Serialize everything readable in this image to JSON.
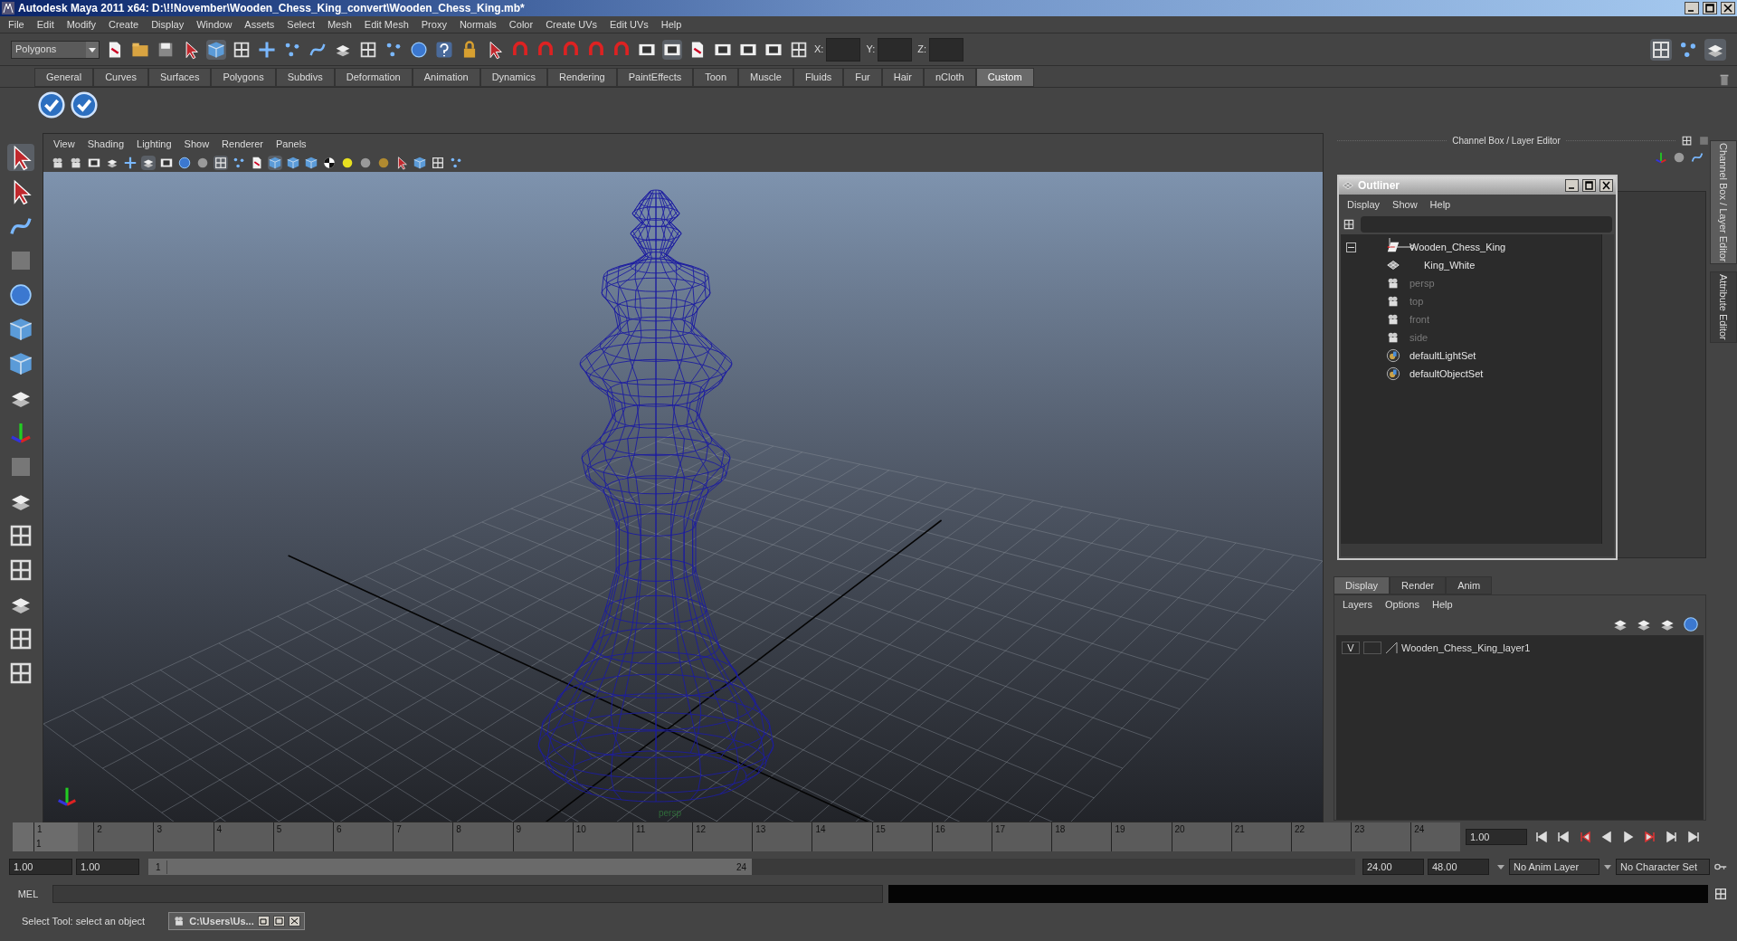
{
  "window": {
    "title": "Autodesk Maya 2011 x64: D:\\!!November\\Wooden_Chess_King_convert\\Wooden_Chess_King.mb*"
  },
  "menu_bar": [
    "File",
    "Edit",
    "Modify",
    "Create",
    "Display",
    "Window",
    "Assets",
    "Select",
    "Mesh",
    "Edit Mesh",
    "Proxy",
    "Normals",
    "Color",
    "Create UVs",
    "Edit UVs",
    "Help"
  ],
  "status_line": {
    "mode": "Polygons",
    "fields": [
      {
        "label": "X:"
      },
      {
        "label": "Y:"
      },
      {
        "label": "Z:"
      }
    ]
  },
  "shelf_tabs": [
    {
      "label": "General",
      "selected": false
    },
    {
      "label": "Curves",
      "selected": false
    },
    {
      "label": "Surfaces",
      "selected": false
    },
    {
      "label": "Polygons",
      "selected": false
    },
    {
      "label": "Subdivs",
      "selected": false
    },
    {
      "label": "Deformation",
      "selected": false
    },
    {
      "label": "Animation",
      "selected": false
    },
    {
      "label": "Dynamics",
      "selected": false
    },
    {
      "label": "Rendering",
      "selected": false
    },
    {
      "label": "PaintEffects",
      "selected": false
    },
    {
      "label": "Toon",
      "selected": false
    },
    {
      "label": "Muscle",
      "selected": false
    },
    {
      "label": "Fluids",
      "selected": false
    },
    {
      "label": "Fur",
      "selected": false
    },
    {
      "label": "Hair",
      "selected": false
    },
    {
      "label": "nCloth",
      "selected": false
    },
    {
      "label": "Custom",
      "selected": true
    }
  ],
  "viewport": {
    "menu": [
      "View",
      "Shading",
      "Lighting",
      "Show",
      "Renderer",
      "Panels"
    ],
    "camera_label": "persp"
  },
  "channel_box": {
    "title": "Channel Box / Layer Editor"
  },
  "side_tabs": [
    {
      "label": "Channel Box / Layer Editor",
      "selected": true
    },
    {
      "label": "Attribute Editor",
      "selected": false
    }
  ],
  "outliner": {
    "title": "Outliner",
    "menu": [
      "Display",
      "Show",
      "Help"
    ],
    "items": [
      {
        "label": "Wooden_Chess_King",
        "kind": "transform",
        "dimmed": false,
        "expanded": true,
        "children": [
          {
            "label": "King_White",
            "kind": "mesh",
            "dimmed": false
          }
        ]
      },
      {
        "label": "persp",
        "kind": "camera",
        "dimmed": true
      },
      {
        "label": "top",
        "kind": "camera",
        "dimmed": true
      },
      {
        "label": "front",
        "kind": "camera",
        "dimmed": true
      },
      {
        "label": "side",
        "kind": "camera",
        "dimmed": true
      },
      {
        "label": "defaultLightSet",
        "kind": "set",
        "dimmed": false
      },
      {
        "label": "defaultObjectSet",
        "kind": "set",
        "dimmed": false
      }
    ]
  },
  "layer_editor": {
    "tabs": [
      {
        "label": "Display",
        "selected": true
      },
      {
        "label": "Render",
        "selected": false
      },
      {
        "label": "Anim",
        "selected": false
      }
    ],
    "menu": [
      "Layers",
      "Options",
      "Help"
    ],
    "layers": [
      {
        "visibility": "V",
        "name": "Wooden_Chess_King_layer1"
      }
    ]
  },
  "timeline": {
    "frames": [
      "1",
      "2",
      "3",
      "4",
      "5",
      "6",
      "7",
      "8",
      "9",
      "10",
      "11",
      "12",
      "13",
      "14",
      "15",
      "16",
      "17",
      "18",
      "19",
      "20",
      "21",
      "22",
      "23",
      "24"
    ],
    "current_frame": "1",
    "current_time": "1.00",
    "level": 0
  },
  "range": {
    "start": "1.00",
    "playback_start": "1.00",
    "slider_start": "1",
    "slider_end": "24",
    "level": 0.5,
    "playback_end": "24.00",
    "end": "48.00",
    "anim_layer": "No Anim Layer",
    "character_set": "No Character Set"
  },
  "command_line": {
    "label": "MEL"
  },
  "help_line": {
    "text": "Select Tool: select an object"
  },
  "taskbar_item": {
    "label": "C:\\Users\\Us..."
  }
}
